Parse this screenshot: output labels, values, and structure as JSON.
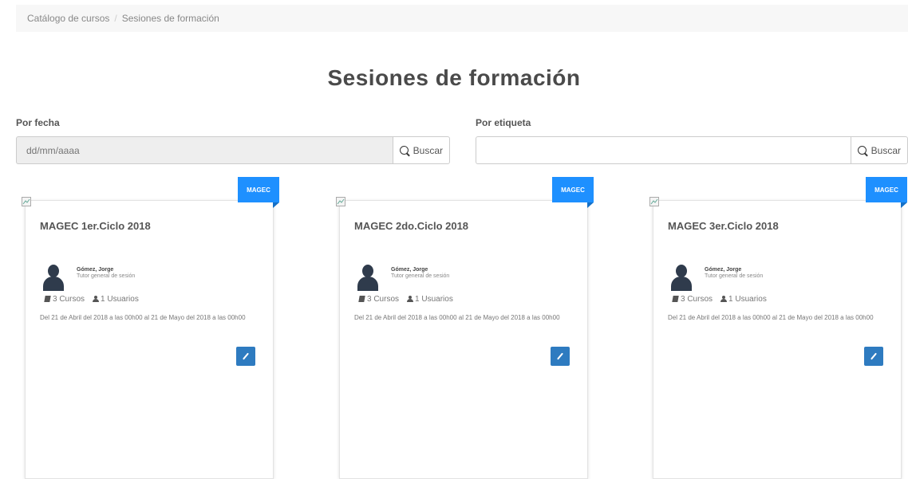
{
  "breadcrumb": {
    "items": [
      "Catálogo de cursos",
      "Sesiones de formación"
    ],
    "separator": "/"
  },
  "page": {
    "title": "Sesiones de formación"
  },
  "filters": {
    "by_date": {
      "label": "Por fecha",
      "placeholder": "dd/mm/aaaa",
      "button": "Buscar"
    },
    "by_tag": {
      "label": "Por etiqueta",
      "placeholder": "",
      "button": "Buscar"
    }
  },
  "cards": [
    {
      "ribbon": "MAGEC",
      "title": "MAGEC 1er.Ciclo 2018",
      "tutor_name": "Gómez, Jorge",
      "tutor_role": "Tutor general de sesión",
      "courses": "3 Cursos",
      "users": "1 Usuarios",
      "dates": "Del 21 de Abril del 2018 a las 00h00 al 21 de Mayo del 2018 a las 00h00"
    },
    {
      "ribbon": "MAGEC",
      "title": "MAGEC 2do.Ciclo 2018",
      "tutor_name": "Gómez, Jorge",
      "tutor_role": "Tutor general de sesión",
      "courses": "3 Cursos",
      "users": "1 Usuarios",
      "dates": "Del 21 de Abril del 2018 a las 00h00 al 21 de Mayo del 2018 a las 00h00"
    },
    {
      "ribbon": "MAGEC",
      "title": "MAGEC 3er.Ciclo 2018",
      "tutor_name": "Gómez, Jorge",
      "tutor_role": "Tutor general de sesión",
      "courses": "3 Cursos",
      "users": "1 Usuarios",
      "dates": "Del 21 de Abril del 2018 a las 00h00 al 21 de Mayo del 2018 a las 00h00"
    }
  ],
  "colors": {
    "accent": "#1e90ff",
    "button": "#2e7bc0",
    "avatar": "#2f3b4c"
  }
}
